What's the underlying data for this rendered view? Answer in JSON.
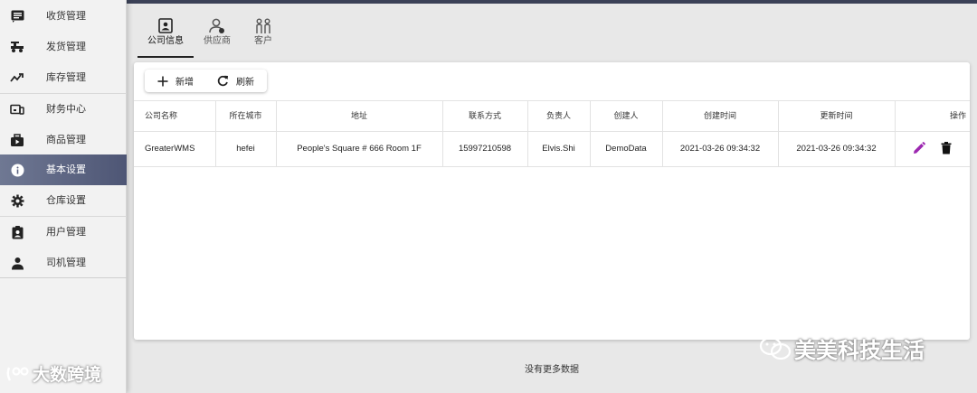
{
  "sidebar": {
    "items": [
      {
        "label": "收货管理",
        "icon": "receipt-list-icon"
      },
      {
        "label": "发货管理",
        "icon": "truck-icon"
      },
      {
        "label": "库存管理",
        "icon": "trend-icon"
      },
      {
        "label": "财务中心",
        "icon": "finance-device-icon"
      },
      {
        "label": "商品管理",
        "icon": "product-box-icon"
      },
      {
        "label": "基本设置",
        "icon": "info-icon",
        "active": true
      },
      {
        "label": "仓库设置",
        "icon": "gear-icon"
      },
      {
        "label": "用户管理",
        "icon": "user-badge-icon"
      },
      {
        "label": "司机管理",
        "icon": "driver-icon"
      }
    ],
    "watermark": "大数跨境"
  },
  "tabs": [
    {
      "label": "公司信息",
      "icon": "company-icon",
      "active": true
    },
    {
      "label": "供应商",
      "icon": "supplier-icon"
    },
    {
      "label": "客户",
      "icon": "customers-icon"
    }
  ],
  "toolbar": {
    "add_label": "新增",
    "refresh_label": "刷新"
  },
  "table": {
    "headers": [
      "公司名称",
      "所在城市",
      "地址",
      "联系方式",
      "负责人",
      "创建人",
      "创建时间",
      "更新时间",
      "操作"
    ],
    "rows": [
      [
        "GreaterWMS",
        "hefei",
        "People's Square # 666 Room 1F",
        "15997210598",
        "Elvis.Shi",
        "DemoData",
        "2021-03-26 09:34:32",
        "2021-03-26 09:34:32"
      ]
    ]
  },
  "footer": {
    "no_more": "没有更多数据"
  },
  "watermark_right": "美美科技生活",
  "colors": {
    "active_nav": "#5b6381",
    "edit_icon": "#9c27b0",
    "top_bar": "#3b4157"
  }
}
